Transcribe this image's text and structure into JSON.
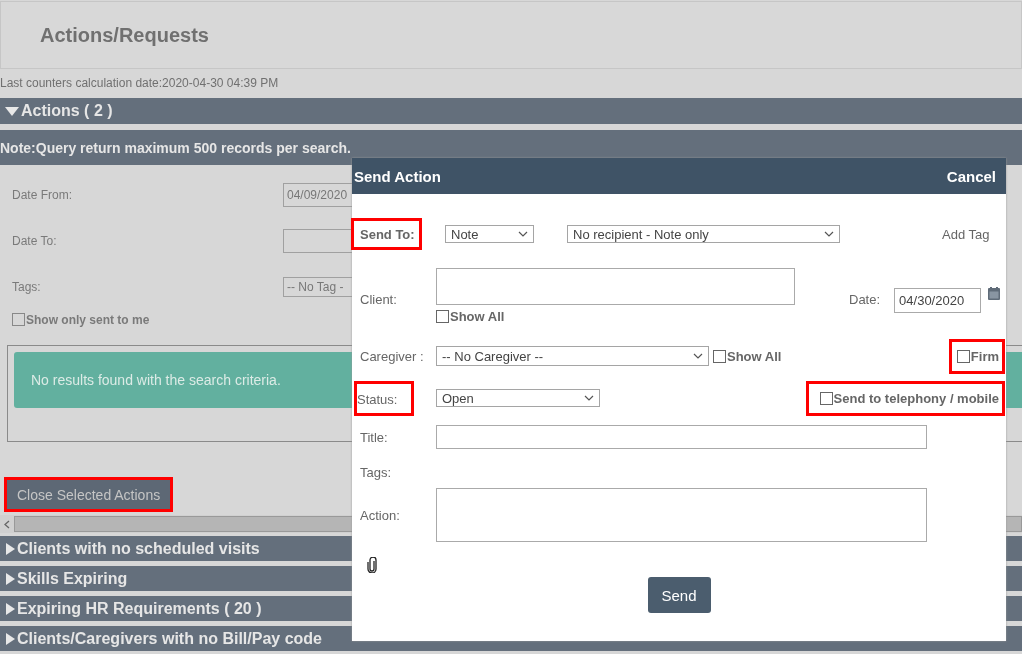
{
  "page": {
    "title": "Actions/Requests",
    "counters_note": "Last counters calculation date:2020-04-30 04:39 PM"
  },
  "actions_section": {
    "label": "Actions ( 2 )",
    "expanded": true
  },
  "note": "Note:Query return maximum 500 records per search.",
  "filters": [
    {
      "label": "Date From:",
      "kind": "field",
      "value": "04/09/2020"
    },
    {
      "label": "Date To:",
      "kind": "field"
    },
    {
      "label": "Tags:",
      "kind": "select",
      "value": "-- No Tag -"
    }
  ],
  "show_only_mine": {
    "label": "Show only sent to me",
    "checked": false
  },
  "empty_message": "No results found with the search criteria.",
  "close_button": {
    "label": "Close Selected Actions",
    "highlighted": true
  },
  "sections": [
    {
      "label": "Clients with no scheduled visits",
      "expanded": false
    },
    {
      "label": "Skills Expiring",
      "expanded": false
    },
    {
      "label": "Expiring HR Requirements ( 20 )",
      "expanded": false
    },
    {
      "label": "Clients/Caregivers with no Bill/Pay code",
      "expanded": false
    }
  ],
  "dialog": {
    "title": "Send Action",
    "cancel": "Cancel",
    "send_to": {
      "label": "Send To:",
      "highlighted": true,
      "type": "Note",
      "recipient": "No recipient - Note only"
    },
    "add_tag": "Add Tag",
    "client": {
      "label": "Client:",
      "show_all": {
        "label": "Show All",
        "checked": false
      }
    },
    "date": {
      "label": "Date:",
      "value": "04/30/2020"
    },
    "caregiver": {
      "label": "Caregiver :",
      "value": "-- No Caregiver --",
      "show_all": {
        "label": "Show All",
        "checked": false
      }
    },
    "firm": {
      "label": "Firm",
      "checked": false,
      "highlighted": true
    },
    "status": {
      "label": "Status:",
      "value": "Open",
      "highlighted": true
    },
    "telephony": {
      "label": "Send to telephony / mobile",
      "checked": false,
      "highlighted": true
    },
    "title_label": "Title:",
    "tags_label": "Tags:",
    "action_label": "Action:",
    "send": "Send"
  }
}
